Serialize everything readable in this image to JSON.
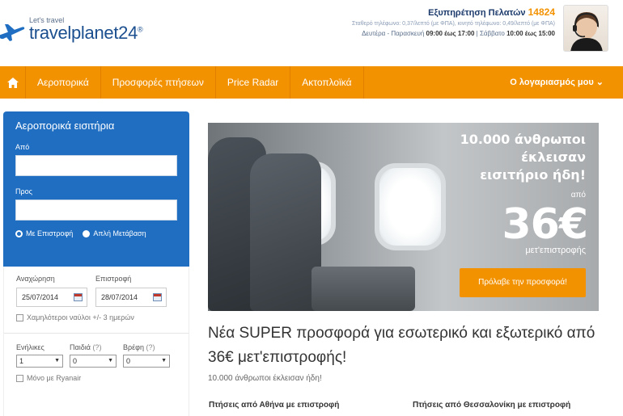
{
  "header": {
    "logo_tagline": "Let's travel",
    "logo_text": "travelplanet24",
    "logo_mark": "®",
    "support_title": "Εξυπηρέτηση Πελατών",
    "support_number": "14824",
    "support_rates": "Σταθερό τηλέφωνο: 0,37/λεπτό (με ΦΠΑ), κινητό τηλέφωνο: 0,49/λεπτό (με ΦΠΑ)",
    "support_hours_prefix": "Δευτέρα - Παρασκευή",
    "support_hours_weekday": "09:00 έως 17:00",
    "support_hours_sep": "|",
    "support_hours_sat_label": "Σάββατο",
    "support_hours_sat": "10:00 έως 15:00"
  },
  "nav": {
    "home_icon": "home-icon",
    "items": [
      {
        "label": "Αεροπορικά"
      },
      {
        "label": "Προσφορές πτήσεων"
      },
      {
        "label": "Price Radar"
      },
      {
        "label": "Ακτοπλοϊκά"
      }
    ],
    "account": "Ο λογαριασμός μου ⌄"
  },
  "search": {
    "title": "Αεροπορικά εισιτήρια",
    "from_label": "Από",
    "from_value": "",
    "to_label": "Προς",
    "to_value": "",
    "radio_roundtrip": "Με Επιστροφή",
    "radio_oneway": "Απλή Μετάβαση",
    "depart_label": "Αναχώρηση",
    "return_label": "Επιστροφή",
    "depart_value": "25/07/2014",
    "return_value": "28/07/2014",
    "flex_label": "Χαμηλότεροι ναύλοι +/- 3 ημερών",
    "adults_label": "Ενήλικες",
    "children_label": "Παιδιά",
    "infants_label": "Βρέφη",
    "help_mark": "(?)",
    "adults_value": "1",
    "children_value": "0",
    "infants_value": "0",
    "ryanair_label": "Μόνο με Ryanair"
  },
  "hero": {
    "line1": "10.000 άνθρωποι",
    "line2": "έκλεισαν",
    "line3": "εισιτήριο ήδη!",
    "from": "από",
    "price": "36€",
    "note": "μετ'επιστροφής",
    "button": "Πρόλαβε την προσφορά!"
  },
  "promo": {
    "title": "Νέα SUPER προσφορά για εσωτερικό και εξωτερικό από 36€ μετ'επιστροφής!",
    "subtitle": "10.000 άνθρωποι έκλεισαν ήδη!",
    "col1": "Πτήσεις από Αθήνα με επιστροφή",
    "col2": "Πτήσεις από Θεσσαλονίκη με επιστροφή"
  },
  "colors": {
    "brand_orange": "#f39200",
    "brand_blue": "#1f6ec2",
    "logo_blue": "#1b4f8f"
  }
}
